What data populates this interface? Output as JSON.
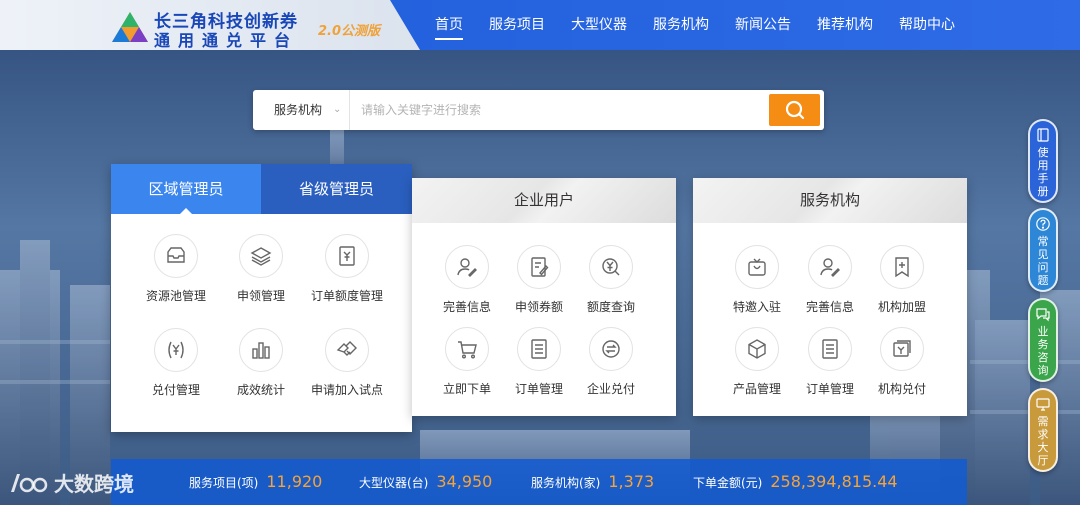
{
  "header": {
    "brand_line1": "长三角科技创新券",
    "brand_line2": "通用通兑平台",
    "version": "2.0公测版",
    "nav": [
      "首页",
      "服务项目",
      "大型仪器",
      "服务机构",
      "新闻公告",
      "推荐机构",
      "帮助中心"
    ],
    "active_nav": "首页",
    "colors": {
      "primary": "#2563df",
      "accent": "#f58c14",
      "brand_text": "#1a47b8",
      "version_text": "#f0a23a"
    }
  },
  "search": {
    "category": "服务机构",
    "placeholder": "请输入关键字进行搜索",
    "button_icon": "search-icon"
  },
  "region_panel": {
    "tabs": [
      "区域管理员",
      "省级管理员"
    ],
    "active_tab": "区域管理员",
    "items": [
      {
        "label": "资源池管理",
        "icon": "inbox-icon"
      },
      {
        "label": "申领管理",
        "icon": "layers-icon"
      },
      {
        "label": "订单额度管理",
        "icon": "yen-document-icon"
      },
      {
        "label": "兑付管理",
        "icon": "yen-bracket-icon"
      },
      {
        "label": "成效统计",
        "icon": "bar-chart-icon"
      },
      {
        "label": "申请加入试点",
        "icon": "handshake-icon"
      }
    ]
  },
  "user_panel": {
    "title": "企业用户",
    "items": [
      {
        "label": "完善信息",
        "icon": "user-edit-icon"
      },
      {
        "label": "申领券额",
        "icon": "document-edit-icon"
      },
      {
        "label": "额度查询",
        "icon": "yen-search-icon"
      },
      {
        "label": "立即下单",
        "icon": "cart-icon"
      },
      {
        "label": "订单管理",
        "icon": "list-document-icon"
      },
      {
        "label": "企业兑付",
        "icon": "exchange-circle-icon"
      }
    ]
  },
  "institution_panel": {
    "title": "服务机构",
    "items": [
      {
        "label": "特邀入驻",
        "icon": "invite-gift-icon"
      },
      {
        "label": "完善信息",
        "icon": "user-edit-icon"
      },
      {
        "label": "机构加盟",
        "icon": "bookmark-plus-icon"
      },
      {
        "label": "产品管理",
        "icon": "cube-icon"
      },
      {
        "label": "订单管理",
        "icon": "list-document-icon"
      },
      {
        "label": "机构兑付",
        "icon": "payment-icon"
      }
    ]
  },
  "stats": [
    {
      "label": "服务项目(项)",
      "value": "11,920"
    },
    {
      "label": "大型仪器(台)",
      "value": "34,950"
    },
    {
      "label": "服务机构(家)",
      "value": "1,373"
    },
    {
      "label": "下单金额(元)",
      "value": "258,394,815.44"
    }
  ],
  "side_tools": [
    {
      "label": "使用手册",
      "icon": "book-icon"
    },
    {
      "label": "常见问题",
      "icon": "question-icon"
    },
    {
      "label": "业务咨询",
      "icon": "chat-icon"
    },
    {
      "label": "需求大厅",
      "icon": "monitor-icon"
    }
  ],
  "watermark": "大数跨境"
}
